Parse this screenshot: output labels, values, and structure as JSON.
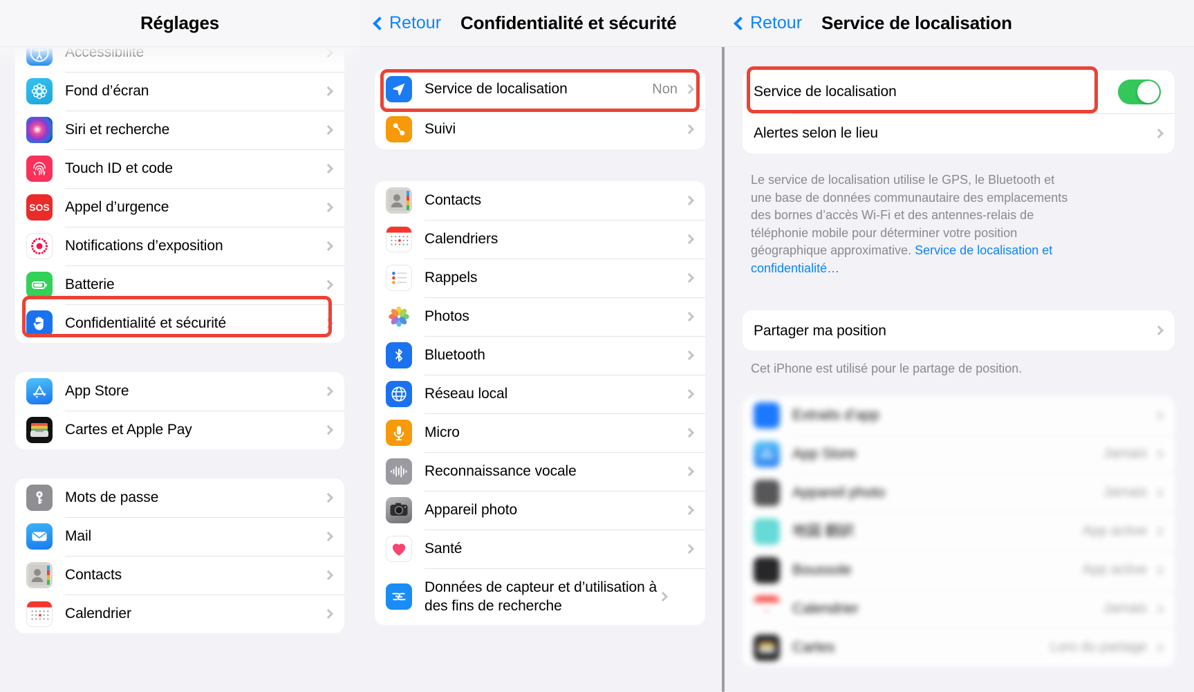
{
  "panel1": {
    "nav": {
      "title": "Réglages"
    },
    "groups": [
      {
        "rows": [
          {
            "label": "Accessibilité",
            "icon": "accessibility-icon"
          },
          {
            "label": "Fond d’écran",
            "icon": "wallpaper-icon"
          },
          {
            "label": "Siri et recherche",
            "icon": "siri-icon"
          },
          {
            "label": "Touch ID et code",
            "icon": "touchid-icon"
          },
          {
            "label": "Appel d’urgence",
            "icon": "sos-icon"
          },
          {
            "label": "Notifications d’exposition",
            "icon": "exposure-notifications-icon"
          },
          {
            "label": "Batterie",
            "icon": "battery-icon"
          },
          {
            "label": "Confidentialité et sécurité",
            "icon": "privacy-hand-icon",
            "highlighted": true
          }
        ]
      },
      {
        "rows": [
          {
            "label": "App Store",
            "icon": "app-store-icon"
          },
          {
            "label": "Cartes et Apple Pay",
            "icon": "wallet-icon"
          }
        ]
      },
      {
        "rows": [
          {
            "label": "Mots de passe",
            "icon": "passwords-key-icon"
          },
          {
            "label": "Mail",
            "icon": "mail-icon"
          },
          {
            "label": "Contacts",
            "icon": "contacts-icon"
          },
          {
            "label": "Calendrier",
            "icon": "calendar-icon"
          }
        ]
      }
    ]
  },
  "panel2": {
    "nav": {
      "back": "Retour",
      "title": "Confidentialité et sécurité"
    },
    "groups": [
      {
        "rows": [
          {
            "label": "Service de localisation",
            "value": "Non",
            "icon": "location-arrow-icon",
            "highlighted": true
          },
          {
            "label": "Suivi",
            "icon": "tracking-icon"
          }
        ]
      },
      {
        "rows": [
          {
            "label": "Contacts",
            "icon": "contacts-icon"
          },
          {
            "label": "Calendriers",
            "icon": "calendar-icon"
          },
          {
            "label": "Rappels",
            "icon": "reminders-icon"
          },
          {
            "label": "Photos",
            "icon": "photos-icon"
          },
          {
            "label": "Bluetooth",
            "icon": "bluetooth-icon"
          },
          {
            "label": "Réseau local",
            "icon": "local-network-icon"
          },
          {
            "label": "Micro",
            "icon": "microphone-icon"
          },
          {
            "label": "Reconnaissance vocale",
            "icon": "speech-recognition-icon"
          },
          {
            "label": "Appareil photo",
            "icon": "camera-icon"
          },
          {
            "label": "Santé",
            "icon": "health-heart-icon"
          },
          {
            "label": "Données de capteur et d’utilisation à des fins de recherche",
            "icon": "research-sensor-icon"
          }
        ]
      }
    ]
  },
  "panel3": {
    "nav": {
      "back": "Retour",
      "title": "Service de localisation"
    },
    "toggle_row": {
      "label": "Service de localisation",
      "state": "on",
      "highlighted": true
    },
    "alerts_row": {
      "label": "Alertes selon le lieu"
    },
    "description": {
      "text": "Le service de localisation utilise le GPS, le Bluetooth et une base de données communautaire des emplacements des bornes d’accès Wi-Fi et des antennes-relais de téléphonie mobile pour déterminer votre position géographique approximative. ",
      "link": "Service de localisation et confidentialité…"
    },
    "share_row": {
      "label": "Partager ma position"
    },
    "share_footnote": "Cet iPhone est utilisé pour le partage de position.",
    "app_list": [
      {
        "label": "Extraits d’app",
        "value": "",
        "icon": "app-clips-icon"
      },
      {
        "label": "App Store",
        "value": "Jamais",
        "icon": "app-store-icon"
      },
      {
        "label": "Appareil photo",
        "value": "Jamais",
        "icon": "camera-icon"
      },
      {
        "label": "地図 翻訳",
        "value": "App active",
        "icon": "teal-app-icon"
      },
      {
        "label": "Boussole",
        "value": "App active",
        "icon": "compass-icon"
      },
      {
        "label": "Calendrier",
        "value": "Jamais",
        "icon": "calendar-icon"
      },
      {
        "label": "Cartes",
        "value": "Lors du partage",
        "icon": "wallet-icon"
      }
    ]
  },
  "colors": {
    "accent_blue": "#0a84ff",
    "toggle_green": "#34c759",
    "highlight_red": "#ea4335",
    "background_grey": "#f2f2f7"
  }
}
